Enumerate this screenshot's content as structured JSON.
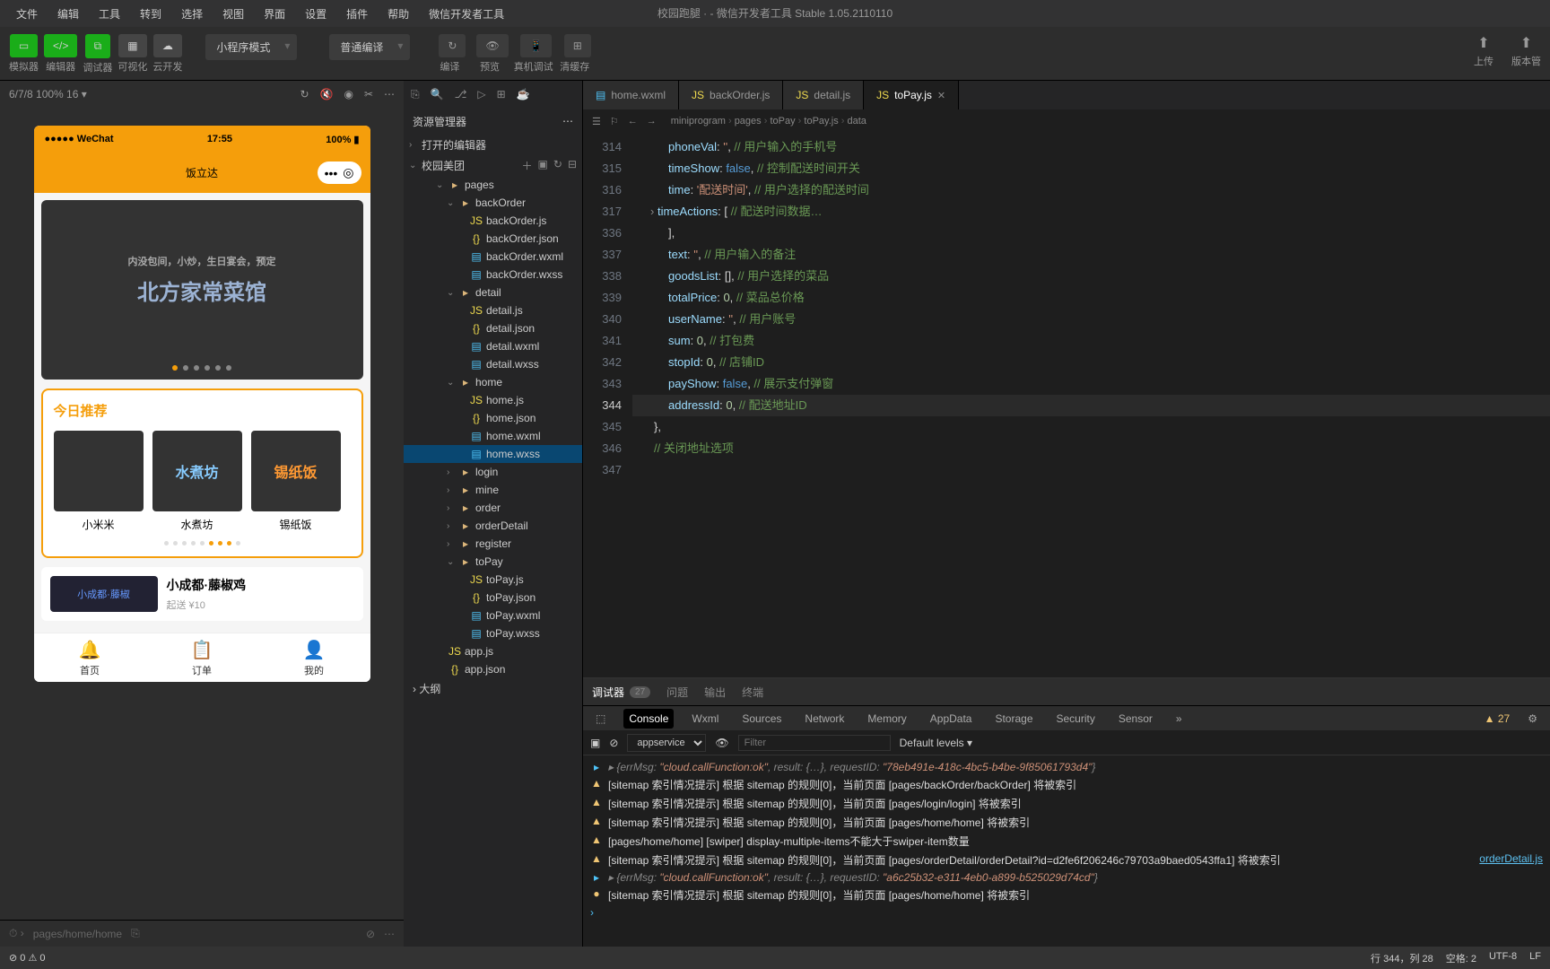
{
  "window": {
    "title": "校园跑腿 · - 微信开发者工具 Stable 1.05.2110110"
  },
  "menu": [
    "文件",
    "编辑",
    "工具",
    "转到",
    "选择",
    "视图",
    "界面",
    "设置",
    "插件",
    "帮助",
    "微信开发者工具"
  ],
  "toolbar": {
    "groups": [
      "模拟器",
      "编辑器",
      "调试器",
      "可视化",
      "云开发"
    ],
    "mode": "小程序模式",
    "compile": "普通编译",
    "actions": [
      "编译",
      "预览",
      "真机调试",
      "清缓存"
    ],
    "right": [
      "上传",
      "版本管"
    ]
  },
  "sim": {
    "device": "6/7/8 100% 16 ▾",
    "status_left": "●●●●● WeChat",
    "status_time": "17:55",
    "status_right": "100%",
    "app_title": "饭立达",
    "banner_title": "北方家常菜馆",
    "banner_sub": "内没包间，小炒，生日宴会，预定",
    "today_title": "今日推荐",
    "recs": [
      "小米米",
      "水煮坊",
      "锡纸饭"
    ],
    "rec_img": [
      "",
      "水煮坊",
      "锡纸饭"
    ],
    "shop_name": "小成都·藤椒鸡",
    "shop_sub": "起送 ¥10",
    "tabs": [
      "首页",
      "订单",
      "我的"
    ],
    "bottom_path": "pages/home/home"
  },
  "explorer": {
    "title": "资源管理器",
    "open_editors": "打开的编辑器",
    "project": "校园美团",
    "outline": "大纲",
    "tree": [
      {
        "d": 3,
        "t": "folder",
        "open": true,
        "name": "pages"
      },
      {
        "d": 4,
        "t": "folder",
        "open": true,
        "name": "backOrder"
      },
      {
        "d": 5,
        "t": "js",
        "name": "backOrder.js"
      },
      {
        "d": 5,
        "t": "json",
        "name": "backOrder.json"
      },
      {
        "d": 5,
        "t": "wxml",
        "name": "backOrder.wxml"
      },
      {
        "d": 5,
        "t": "wxss",
        "name": "backOrder.wxss"
      },
      {
        "d": 4,
        "t": "folder",
        "open": true,
        "name": "detail"
      },
      {
        "d": 5,
        "t": "js",
        "name": "detail.js"
      },
      {
        "d": 5,
        "t": "json",
        "name": "detail.json"
      },
      {
        "d": 5,
        "t": "wxml",
        "name": "detail.wxml"
      },
      {
        "d": 5,
        "t": "wxss",
        "name": "detail.wxss"
      },
      {
        "d": 4,
        "t": "folder",
        "open": true,
        "name": "home"
      },
      {
        "d": 5,
        "t": "js",
        "name": "home.js"
      },
      {
        "d": 5,
        "t": "json",
        "name": "home.json"
      },
      {
        "d": 5,
        "t": "wxml",
        "name": "home.wxml"
      },
      {
        "d": 5,
        "t": "wxss",
        "name": "home.wxss",
        "sel": true
      },
      {
        "d": 4,
        "t": "folder",
        "open": false,
        "name": "login"
      },
      {
        "d": 4,
        "t": "folder",
        "open": false,
        "name": "mine"
      },
      {
        "d": 4,
        "t": "folder",
        "open": false,
        "name": "order"
      },
      {
        "d": 4,
        "t": "folder",
        "open": false,
        "name": "orderDetail"
      },
      {
        "d": 4,
        "t": "folder",
        "open": false,
        "name": "register"
      },
      {
        "d": 4,
        "t": "folder",
        "open": true,
        "name": "toPay"
      },
      {
        "d": 5,
        "t": "js",
        "name": "toPay.js"
      },
      {
        "d": 5,
        "t": "json",
        "name": "toPay.json"
      },
      {
        "d": 5,
        "t": "wxml",
        "name": "toPay.wxml"
      },
      {
        "d": 5,
        "t": "wxss",
        "name": "toPay.wxss"
      },
      {
        "d": 3,
        "t": "js",
        "name": "app.js"
      },
      {
        "d": 3,
        "t": "json",
        "name": "app.json"
      }
    ]
  },
  "tabs": [
    {
      "icon": "wxml",
      "label": "home.wxml"
    },
    {
      "icon": "js",
      "label": "backOrder.js"
    },
    {
      "icon": "js",
      "label": "detail.js"
    },
    {
      "icon": "js",
      "label": "toPay.js",
      "active": true
    }
  ],
  "breadcrumb": [
    "miniprogram",
    "pages",
    "toPay",
    "toPay.js",
    "data"
  ],
  "code": {
    "start": 314,
    "current": 344,
    "lines": [
      {
        "n": 314,
        "html": "<span class='k'>phoneVal</span><span class='p'>: </span><span class='s'>''</span><span class='p'>, </span><span class='c'>// 用户输入的手机号</span>"
      },
      {
        "n": 315,
        "html": "<span class='k'>timeShow</span><span class='p'>: </span><span class='b'>false</span><span class='p'>, </span><span class='c'>// 控制配送时间开关</span>"
      },
      {
        "n": 316,
        "html": "<span class='k'>time</span><span class='p'>: </span><span class='s'>'配送时间'</span><span class='p'>, </span><span class='c'>// 用户选择的配送时间</span>"
      },
      {
        "n": 317,
        "html": "<span class='k'>timeActions</span><span class='p'>: [ </span><span class='c'>// 配送时间数据…</span>",
        "fold": true
      },
      {
        "n": 336,
        "html": "<span class='p'>],</span>"
      },
      {
        "n": 337,
        "html": "<span class='k'>text</span><span class='p'>: </span><span class='s'>''</span><span class='p'>, </span><span class='c'>// 用户输入的备注</span>"
      },
      {
        "n": 338,
        "html": "<span class='k'>goodsList</span><span class='p'>: [], </span><span class='c'>// 用户选择的菜品</span>"
      },
      {
        "n": 339,
        "html": "<span class='k'>totalPrice</span><span class='p'>: </span><span class='n'>0</span><span class='p'>, </span><span class='c'>// 菜品总价格</span>"
      },
      {
        "n": 340,
        "html": "<span class='k'>userName</span><span class='p'>: </span><span class='s'>''</span><span class='p'>, </span><span class='c'>// 用户账号</span>"
      },
      {
        "n": 341,
        "html": "<span class='k'>sum</span><span class='p'>: </span><span class='n'>0</span><span class='p'>, </span><span class='c'>// 打包费</span>"
      },
      {
        "n": 342,
        "html": "<span class='k'>stopId</span><span class='p'>: </span><span class='n'>0</span><span class='p'>, </span><span class='c'>// 店铺ID</span>"
      },
      {
        "n": 343,
        "html": "<span class='k'>payShow</span><span class='p'>: </span><span class='b'>false</span><span class='p'>, </span><span class='c'>// 展示支付弹窗</span>"
      },
      {
        "n": 344,
        "html": "<span class='k'>addressId</span><span class='p'>: </span><span class='n'>0</span><span class='p'>, </span><span class='c'>// 配送地址ID</span>",
        "cur": true
      },
      {
        "n": 345,
        "html": "<span class='p'>},</span>"
      },
      {
        "n": 346,
        "html": ""
      },
      {
        "n": 347,
        "html": "<span class='c'>// 关闭地址选项</span>"
      }
    ]
  },
  "panel": {
    "tabs": [
      "调试器",
      "问题",
      "输出",
      "终端"
    ],
    "badge": "27",
    "devtabs": [
      "Console",
      "Wxml",
      "Sources",
      "Network",
      "Memory",
      "AppData",
      "Storage",
      "Security",
      "Sensor"
    ],
    "warn_count": "▲ 27",
    "context": "appservice",
    "filter_ph": "Filter",
    "levels": "Default levels ▾",
    "logs": [
      {
        "t": "info",
        "text": "▸ {errMsg: \"cloud.callFunction:ok\", result: {…}, requestID: \"78eb491e-418c-4bc5-b4be-9f85061793d4\"}"
      },
      {
        "t": "warn",
        "text": "[sitemap 索引情况提示] 根据 sitemap 的规则[0]，当前页面 [pages/backOrder/backOrder] 将被索引"
      },
      {
        "t": "warn",
        "text": "[sitemap 索引情况提示] 根据 sitemap 的规则[0]，当前页面 [pages/login/login] 将被索引"
      },
      {
        "t": "warn",
        "text": "[sitemap 索引情况提示] 根据 sitemap 的规则[0]，当前页面 [pages/home/home] 将被索引"
      },
      {
        "t": "warn",
        "text": "[pages/home/home] [swiper] display-multiple-items不能大于swiper-item数量"
      },
      {
        "t": "warn",
        "text": "[sitemap 索引情况提示] 根据 sitemap 的规则[0]，当前页面 [pages/orderDetail/orderDetail?id=d2fe6f206246c79703a9baed0543ffa1] 将被索引",
        "src": "orderDetail.js"
      },
      {
        "t": "info",
        "text": "▸ {errMsg: \"cloud.callFunction:ok\", result: {…}, requestID: \"a6c25b32-e311-4eb0-a899-b525029d74cd\"}"
      },
      {
        "t": "warn",
        "text": "[sitemap 索引情况提示] 根据 sitemap 的规则[0]，当前页面 [pages/home/home] 将被索引",
        "dot": true
      }
    ],
    "prompt": "›"
  },
  "status": {
    "left": [
      "⊘ 0 ⚠ 0"
    ],
    "right": [
      "行 344，列 28",
      "空格: 2",
      "UTF-8",
      "LF"
    ]
  }
}
